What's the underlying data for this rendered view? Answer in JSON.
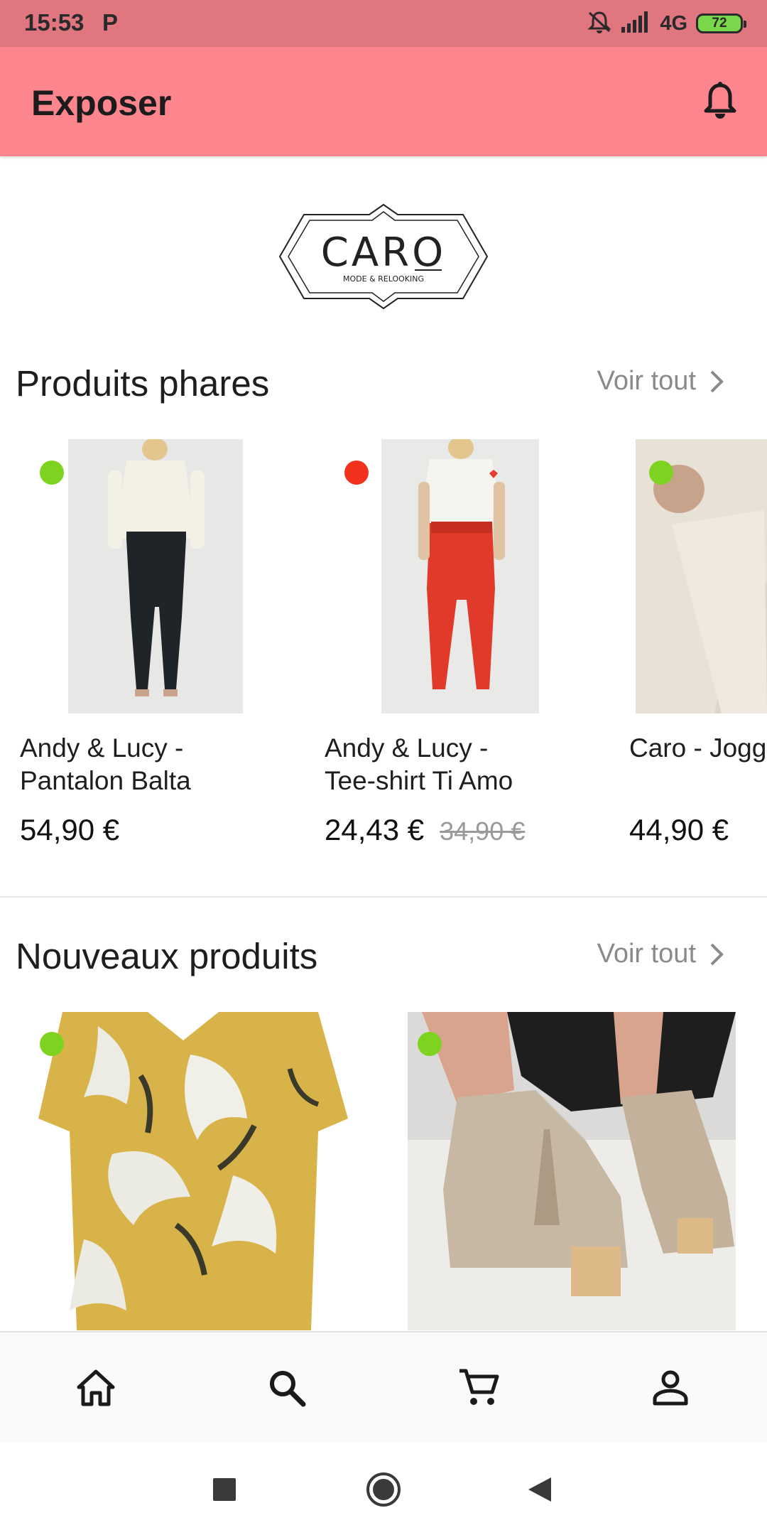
{
  "status_bar": {
    "time": "15:53",
    "carrier_glyph": "P",
    "network": "4G",
    "battery": "72",
    "icons": [
      "mute-icon",
      "signal-icon",
      "battery-icon"
    ]
  },
  "app_bar": {
    "title": "Exposer",
    "notification_icon": "bell-icon"
  },
  "logo": {
    "brand": "CARO",
    "tagline": "MODE & RELOOKING"
  },
  "featured": {
    "title": "Produits phares",
    "see_all": "Voir tout",
    "products": [
      {
        "name": "Andy & Lucy -\nPantalon Balta",
        "price": "54,90 €",
        "old_price": "",
        "stock_color": "#7ed321"
      },
      {
        "name": "Andy & Lucy -\nTee-shirt Ti Amo",
        "price": "24,43 €",
        "old_price": "34,90 €",
        "stock_color": "#f2311d"
      },
      {
        "name": "Caro - Jogg",
        "price": "44,90 €",
        "old_price": "",
        "stock_color": "#7ed321"
      }
    ]
  },
  "new_products": {
    "title": "Nouveaux produits",
    "see_all": "Voir tout",
    "products": [
      {
        "stock_color": "#7ed321"
      },
      {
        "stock_color": "#7ed321"
      }
    ]
  },
  "bottom_nav": {
    "items": [
      "home-icon",
      "search-icon",
      "cart-icon",
      "account-icon"
    ]
  },
  "system_nav": {
    "items": [
      "recents-button",
      "home-button",
      "back-button"
    ]
  },
  "colors": {
    "status_bar": "#e07680",
    "app_bar": "#fd858d",
    "in_stock": "#7ed321",
    "low_stock": "#f2311d"
  }
}
